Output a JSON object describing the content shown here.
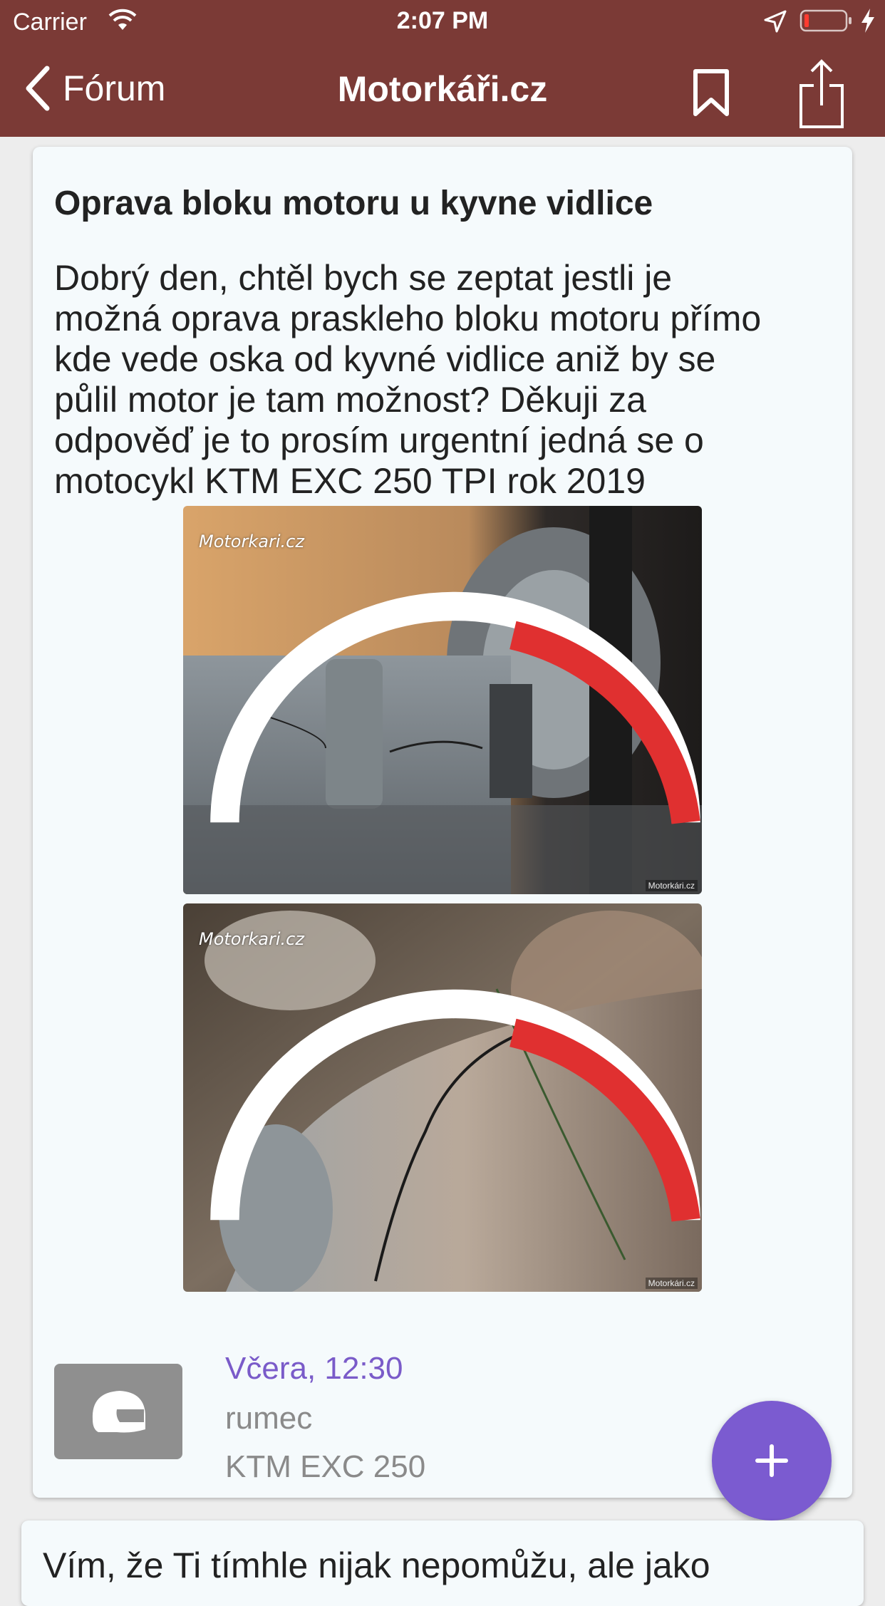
{
  "status_bar": {
    "carrier": "Carrier",
    "time": "2:07 PM",
    "icons": [
      "wifi-icon",
      "location-icon",
      "battery-icon",
      "charging-icon"
    ]
  },
  "nav": {
    "back_label": "Fórum",
    "title": "Motorkáři.cz",
    "icons": [
      "chevron-left-icon",
      "bookmark-icon",
      "share-icon"
    ]
  },
  "post": {
    "title": "Oprava bloku motoru u kyvne vidlice",
    "body_lines": [
      "Dobrý den, chtěl bych se zeptat jestli je",
      "možná oprava praskleho bloku motoru přímo",
      "kde vede oska od kyvné vidlice aniž by se",
      "půlil motor je tam možnost? Děkuji za",
      "odpověď je to prosím urgentní jedná se o",
      "motocykl KTM EXC 250 TPI rok 2019"
    ],
    "photos": [
      {
        "watermark": "Motorkari.cz",
        "corner_watermark": "Motorkári.cz"
      },
      {
        "watermark": "Motorkari.cz",
        "corner_watermark": "Motorkári.cz"
      }
    ],
    "date": "Včera, 12:30",
    "author": "rumec",
    "bike": "KTM EXC 250",
    "avatar_icon": "helmet-icon"
  },
  "fab": {
    "icon": "plus-icon"
  },
  "reply_preview": {
    "text": "Vím, že Ti tímhle nijak nepomůžu, ale jako"
  },
  "colors": {
    "header": "#7b3a36",
    "accent": "#7b5bd0",
    "date": "#7a5bc9",
    "muted": "#8a8a8a",
    "card": "#f5fafc"
  }
}
